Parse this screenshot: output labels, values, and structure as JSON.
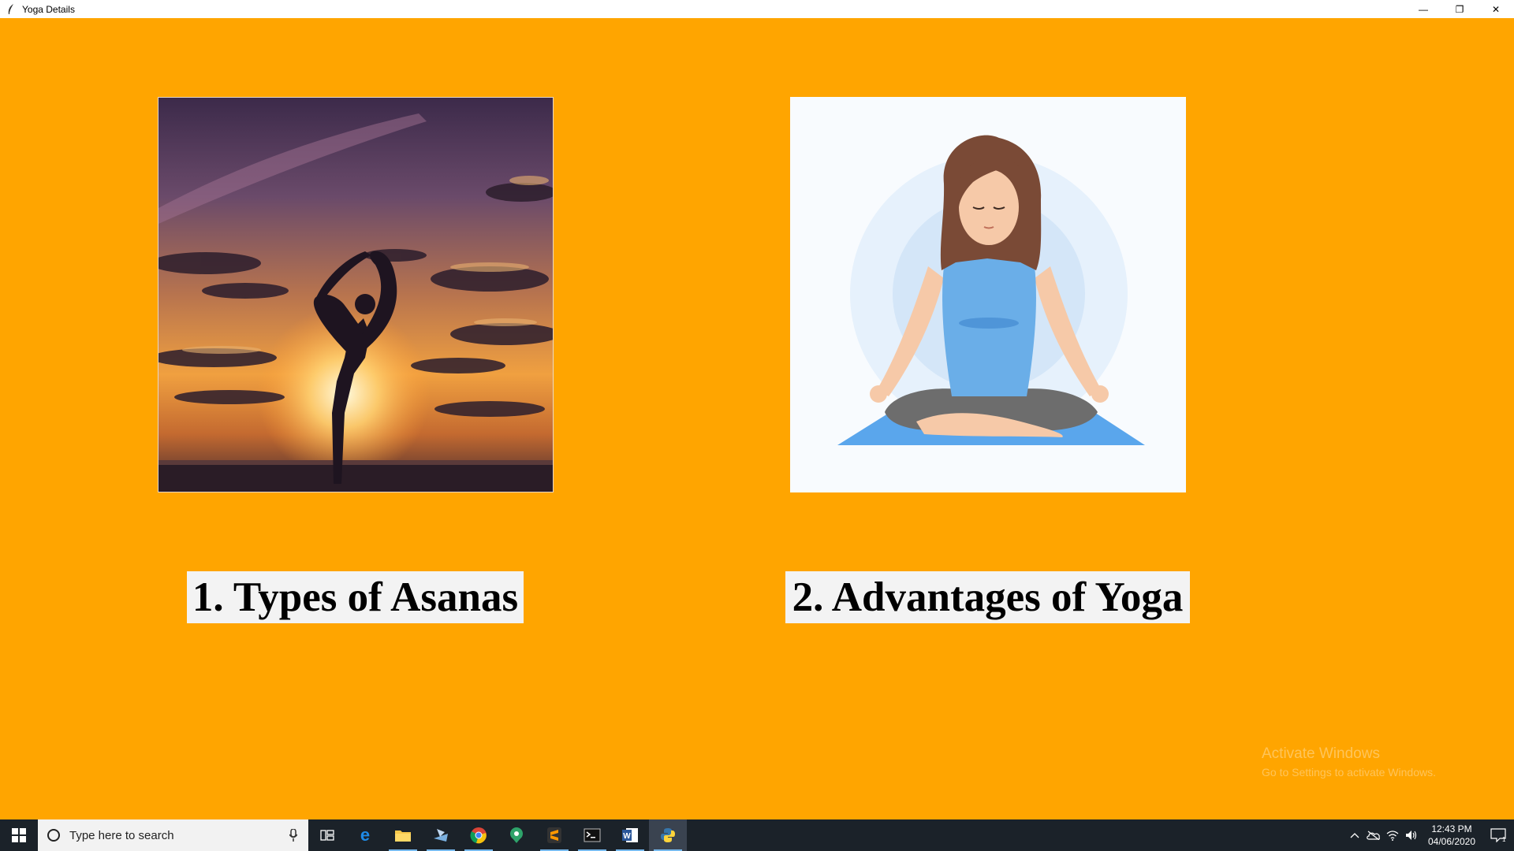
{
  "window": {
    "title": "Yoga Details",
    "controls": {
      "minimize": "—",
      "restore": "❐",
      "close": "✕"
    }
  },
  "main": {
    "background": "#FFA500",
    "cards": [
      {
        "label": "1. Types of Asanas",
        "image": "sunset-yoga-silhouette"
      },
      {
        "label": "2. Advantages of Yoga",
        "image": "meditating-woman-illustration"
      }
    ]
  },
  "watermark": {
    "line1": "Activate Windows",
    "line2": "Go to Settings to activate Windows."
  },
  "taskbar": {
    "search_placeholder": "Type here to search",
    "apps": [
      "task-view-icon",
      "edge-icon",
      "file-explorer-icon",
      "app-icon",
      "chrome-icon",
      "maps-icon",
      "sublime-icon",
      "terminal-icon",
      "word-icon",
      "python-icon"
    ],
    "clock_time": "12:43 PM",
    "clock_date": "04/06/2020",
    "notification_count": "1"
  }
}
